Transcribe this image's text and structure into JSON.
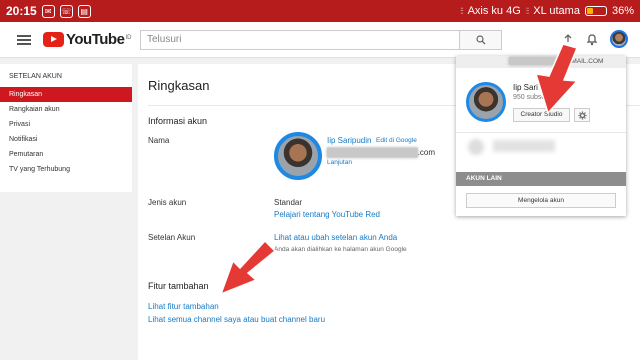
{
  "status_bar": {
    "time": "20:15",
    "carrier1": "Axis ku 4G",
    "carrier2": "XL utama",
    "battery": "36%",
    "battery_level": 0.36,
    "battery_color": "#ffb300"
  },
  "header": {
    "logo_text": "YouTube",
    "country": "ID",
    "search_placeholder": "Telusuri"
  },
  "sidebar": {
    "title": "SETELAN AKUN",
    "items": [
      {
        "label": "Ringkasan",
        "active": true
      },
      {
        "label": "Rangkaian akun"
      },
      {
        "label": "Privasi"
      },
      {
        "label": "Notifikasi"
      },
      {
        "label": "Pemutaran"
      },
      {
        "label": "TV yang Terhubung"
      }
    ]
  },
  "main": {
    "title": "Ringkasan",
    "account_info_heading": "Informasi akun",
    "name_label": "Nama",
    "user_name": "Iip Saripudin",
    "edit_link": "Edit di Google",
    "email_suffix": ".com",
    "advanced_link": "Lanjutan",
    "account_type_label": "Jenis akun",
    "account_type_value": "Standar",
    "youtube_red_link": "Pelajari tentang YouTube Red",
    "account_settings_label": "Setelan Akun",
    "account_settings_link": "Lihat atau ubah setelan akun Anda",
    "account_settings_note": "Anda akan dialihkan ke halaman akun Google",
    "extra_features_heading": "Fitur tambahan",
    "extra_features_link": "Lihat fitur tambahan",
    "all_channels_link": "Lihat semua channel saya atau buat channel baru"
  },
  "dropdown": {
    "email_suffix": "@GMAIL.COM",
    "name": "Iip Sari",
    "subscribers": "950 subscriber",
    "creator_studio": "Creator Studio",
    "other_accounts": "AKUN LAIN",
    "manage_accounts": "Mengelola akun"
  },
  "colors": {
    "yt_red": "#e62117",
    "accent_blue": "#1e88e5",
    "link_blue": "#167ac6",
    "arrow_red": "#e53935"
  }
}
